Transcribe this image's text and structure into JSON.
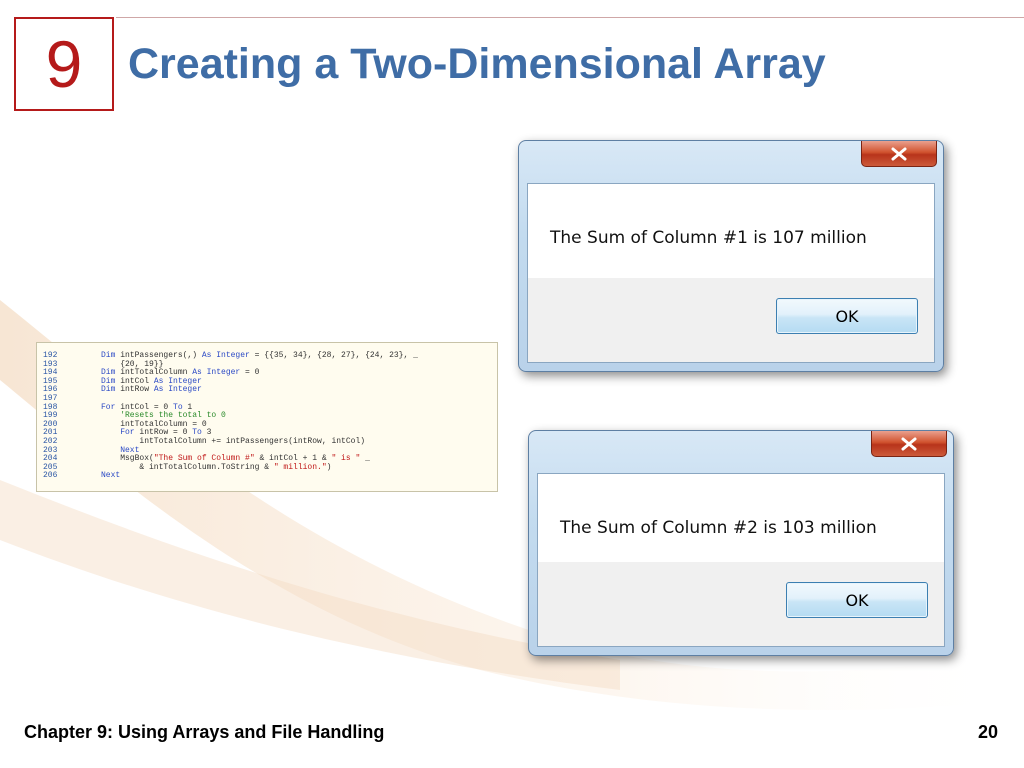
{
  "slide": {
    "chapter_number": "9",
    "title": "Creating a Two-Dimensional Array",
    "footer_text": "Chapter 9: Using Arrays and File Handling",
    "page_number": "20"
  },
  "colors": {
    "accent_red": "#b51a1a",
    "title_blue": "#3f6da6",
    "code_keyword": "#2b49c5",
    "code_comment": "#2a8a2a",
    "code_string": "#c01818"
  },
  "code": {
    "lines": [
      {
        "num": "192",
        "parts": [
          {
            "t": "Dim",
            "k": "kw"
          },
          {
            "t": " intPassengers(,) "
          },
          {
            "t": "As Integer",
            "k": "kw"
          },
          {
            "t": " = {{35, 34}, {28, 27}, {24, 23}, _"
          }
        ]
      },
      {
        "num": "193",
        "parts": [
          {
            "t": "    {20, 19}}"
          }
        ]
      },
      {
        "num": "194",
        "parts": [
          {
            "t": "Dim",
            "k": "kw"
          },
          {
            "t": " intTotalColumn "
          },
          {
            "t": "As Integer",
            "k": "kw"
          },
          {
            "t": " = 0"
          }
        ]
      },
      {
        "num": "195",
        "parts": [
          {
            "t": "Dim",
            "k": "kw"
          },
          {
            "t": " intCol "
          },
          {
            "t": "As Integer",
            "k": "kw"
          }
        ]
      },
      {
        "num": "196",
        "parts": [
          {
            "t": "Dim",
            "k": "kw"
          },
          {
            "t": " intRow "
          },
          {
            "t": "As Integer",
            "k": "kw"
          }
        ]
      },
      {
        "num": "197",
        "parts": []
      },
      {
        "num": "198",
        "parts": [
          {
            "t": "For",
            "k": "kw"
          },
          {
            "t": " intCol = 0 "
          },
          {
            "t": "To",
            "k": "kw"
          },
          {
            "t": " 1"
          }
        ]
      },
      {
        "num": "199",
        "parts": [
          {
            "t": "    'Resets the total to 0",
            "k": "cm"
          }
        ]
      },
      {
        "num": "200",
        "parts": [
          {
            "t": "    intTotalColumn = 0"
          }
        ]
      },
      {
        "num": "201",
        "parts": [
          {
            "t": "    "
          },
          {
            "t": "For",
            "k": "kw"
          },
          {
            "t": " intRow = 0 "
          },
          {
            "t": "To",
            "k": "kw"
          },
          {
            "t": " 3"
          }
        ]
      },
      {
        "num": "202",
        "parts": [
          {
            "t": "        intTotalColumn += intPassengers(intRow, intCol)"
          }
        ]
      },
      {
        "num": "203",
        "parts": [
          {
            "t": "    "
          },
          {
            "t": "Next",
            "k": "kw"
          }
        ]
      },
      {
        "num": "204",
        "parts": [
          {
            "t": "    MsgBox("
          },
          {
            "t": "\"The Sum of Column #\"",
            "k": "st"
          },
          {
            "t": " & intCol + 1 & "
          },
          {
            "t": "\" is \"",
            "k": "st"
          },
          {
            "t": " _"
          }
        ]
      },
      {
        "num": "205",
        "parts": [
          {
            "t": "        & intTotalColumn.ToString & "
          },
          {
            "t": "\" million.\"",
            "k": "st"
          },
          {
            "t": ")"
          }
        ]
      },
      {
        "num": "206",
        "parts": [
          {
            "t": "Next",
            "k": "kw"
          }
        ]
      }
    ]
  },
  "dialogs": [
    {
      "message": "The Sum of Column #1 is 107 million",
      "ok_label": "OK",
      "close_icon": "close-x-icon"
    },
    {
      "message": "The Sum of Column #2 is 103 million",
      "ok_label": "OK",
      "close_icon": "close-x-icon"
    }
  ]
}
